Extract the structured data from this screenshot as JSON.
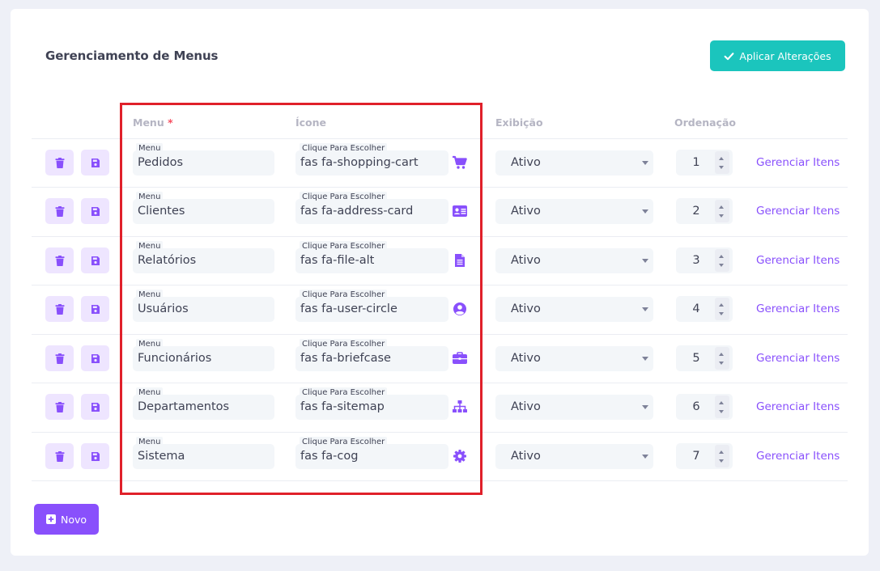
{
  "page": {
    "title": "Gerenciamento de Menus",
    "apply_label": "Aplicar Alterações",
    "new_label": "Novo"
  },
  "headers": {
    "menu": "Menu",
    "required_mark": "*",
    "icon": "Ícone",
    "display": "Exibição",
    "order": "Ordenação"
  },
  "labels": {
    "menu_field": "Menu",
    "icon_field": "Clique Para Escolher",
    "manage_link": "Gerenciar Itens"
  },
  "colors": {
    "accent_purple": "#8950fc",
    "accent_teal": "#1bc5bd",
    "highlight_red": "#e0202a"
  },
  "rows": [
    {
      "menu": "Pedidos",
      "icon_class": "fas fa-shopping-cart",
      "icon_name": "shopping-cart-icon",
      "status": "Ativo",
      "order": "1"
    },
    {
      "menu": "Clientes",
      "icon_class": "fas fa-address-card",
      "icon_name": "address-card-icon",
      "status": "Ativo",
      "order": "2"
    },
    {
      "menu": "Relatórios",
      "icon_class": "fas fa-file-alt",
      "icon_name": "file-alt-icon",
      "status": "Ativo",
      "order": "3"
    },
    {
      "menu": "Usuários",
      "icon_class": "fas fa-user-circle",
      "icon_name": "user-circle-icon",
      "status": "Ativo",
      "order": "4"
    },
    {
      "menu": "Funcionários",
      "icon_class": "fas fa-briefcase",
      "icon_name": "briefcase-icon",
      "status": "Ativo",
      "order": "5"
    },
    {
      "menu": "Departamentos",
      "icon_class": "fas fa-sitemap",
      "icon_name": "sitemap-icon",
      "status": "Ativo",
      "order": "6"
    },
    {
      "menu": "Sistema",
      "icon_class": "fas fa-cog",
      "icon_name": "cog-icon",
      "status": "Ativo",
      "order": "7"
    }
  ]
}
